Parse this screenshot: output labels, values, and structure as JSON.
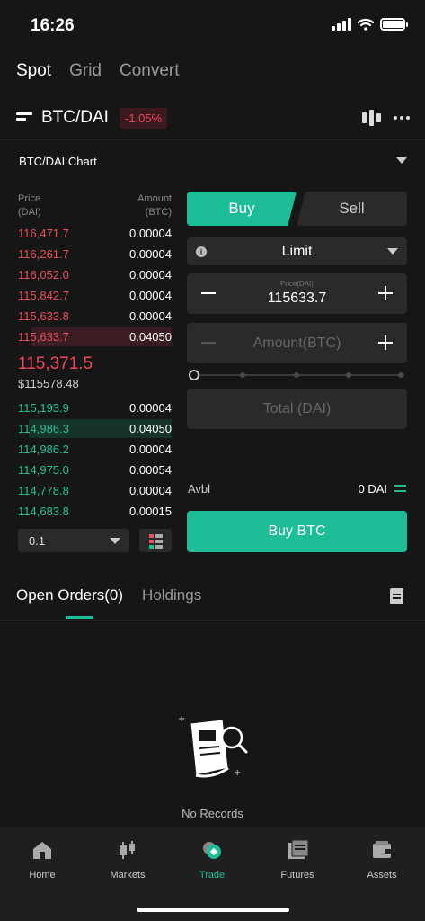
{
  "status_bar": {
    "time": "16:26"
  },
  "top_tabs": [
    {
      "label": "Spot",
      "active": true
    },
    {
      "label": "Grid",
      "active": false
    },
    {
      "label": "Convert",
      "active": false
    }
  ],
  "pair": {
    "name": "BTC/DAI",
    "change": "-1.05%"
  },
  "chart_toggle": {
    "label": "BTC/DAI Chart"
  },
  "order_book": {
    "price_header": "Price",
    "price_unit": "(DAI)",
    "amount_header": "Amount",
    "amount_unit": "(BTC)",
    "asks": [
      {
        "price": "116,471.7",
        "amount": "0.00004",
        "depth": 0.0
      },
      {
        "price": "116,261.7",
        "amount": "0.00004",
        "depth": 0.0
      },
      {
        "price": "116,052.0",
        "amount": "0.00004",
        "depth": 0.0
      },
      {
        "price": "115,842.7",
        "amount": "0.00004",
        "depth": 0.0
      },
      {
        "price": "115,633.8",
        "amount": "0.00004",
        "depth": 0.0
      },
      {
        "price": "115,633.7",
        "amount": "0.04050",
        "depth": 0.91
      }
    ],
    "last_price": "115,371.5",
    "last_price_fiat": "$115578.48",
    "bids": [
      {
        "price": "115,193.9",
        "amount": "0.00004",
        "depth": 0.0
      },
      {
        "price": "114,986.3",
        "amount": "0.04050",
        "depth": 0.93
      },
      {
        "price": "114,986.2",
        "amount": "0.00004",
        "depth": 0.0
      },
      {
        "price": "114,975.0",
        "amount": "0.00054",
        "depth": 0.0
      },
      {
        "price": "114,778.8",
        "amount": "0.00004",
        "depth": 0.0
      },
      {
        "price": "114,683.8",
        "amount": "0.00015",
        "depth": 0.0
      }
    ],
    "precision": "0.1"
  },
  "order_form": {
    "buy_label": "Buy",
    "sell_label": "Sell",
    "order_type": "Limit",
    "price_label": "Price(DAI)",
    "price_value": "115633.7",
    "amount_placeholder": "Amount(BTC)",
    "total_placeholder": "Total (DAI)",
    "slider_percent": 0,
    "avbl_label": "Avbl",
    "avbl_value": "0 DAI",
    "submit_label": "Buy BTC"
  },
  "orders_tabs": [
    {
      "label": "Open Orders(0)",
      "active": true
    },
    {
      "label": "Holdings",
      "active": false
    }
  ],
  "empty_state": {
    "label": "No Records"
  },
  "bottom_nav": [
    {
      "label": "Home",
      "icon": "home-icon",
      "active": false
    },
    {
      "label": "Markets",
      "icon": "markets-icon",
      "active": false
    },
    {
      "label": "Trade",
      "icon": "trade-icon",
      "active": true
    },
    {
      "label": "Futures",
      "icon": "futures-icon",
      "active": false
    },
    {
      "label": "Assets",
      "icon": "assets-icon",
      "active": false
    }
  ],
  "colors": {
    "accent": "#1dbd98",
    "ask": "#e8505b",
    "bid": "#25c196",
    "background": "#161616",
    "surface": "#2a2a2a"
  }
}
